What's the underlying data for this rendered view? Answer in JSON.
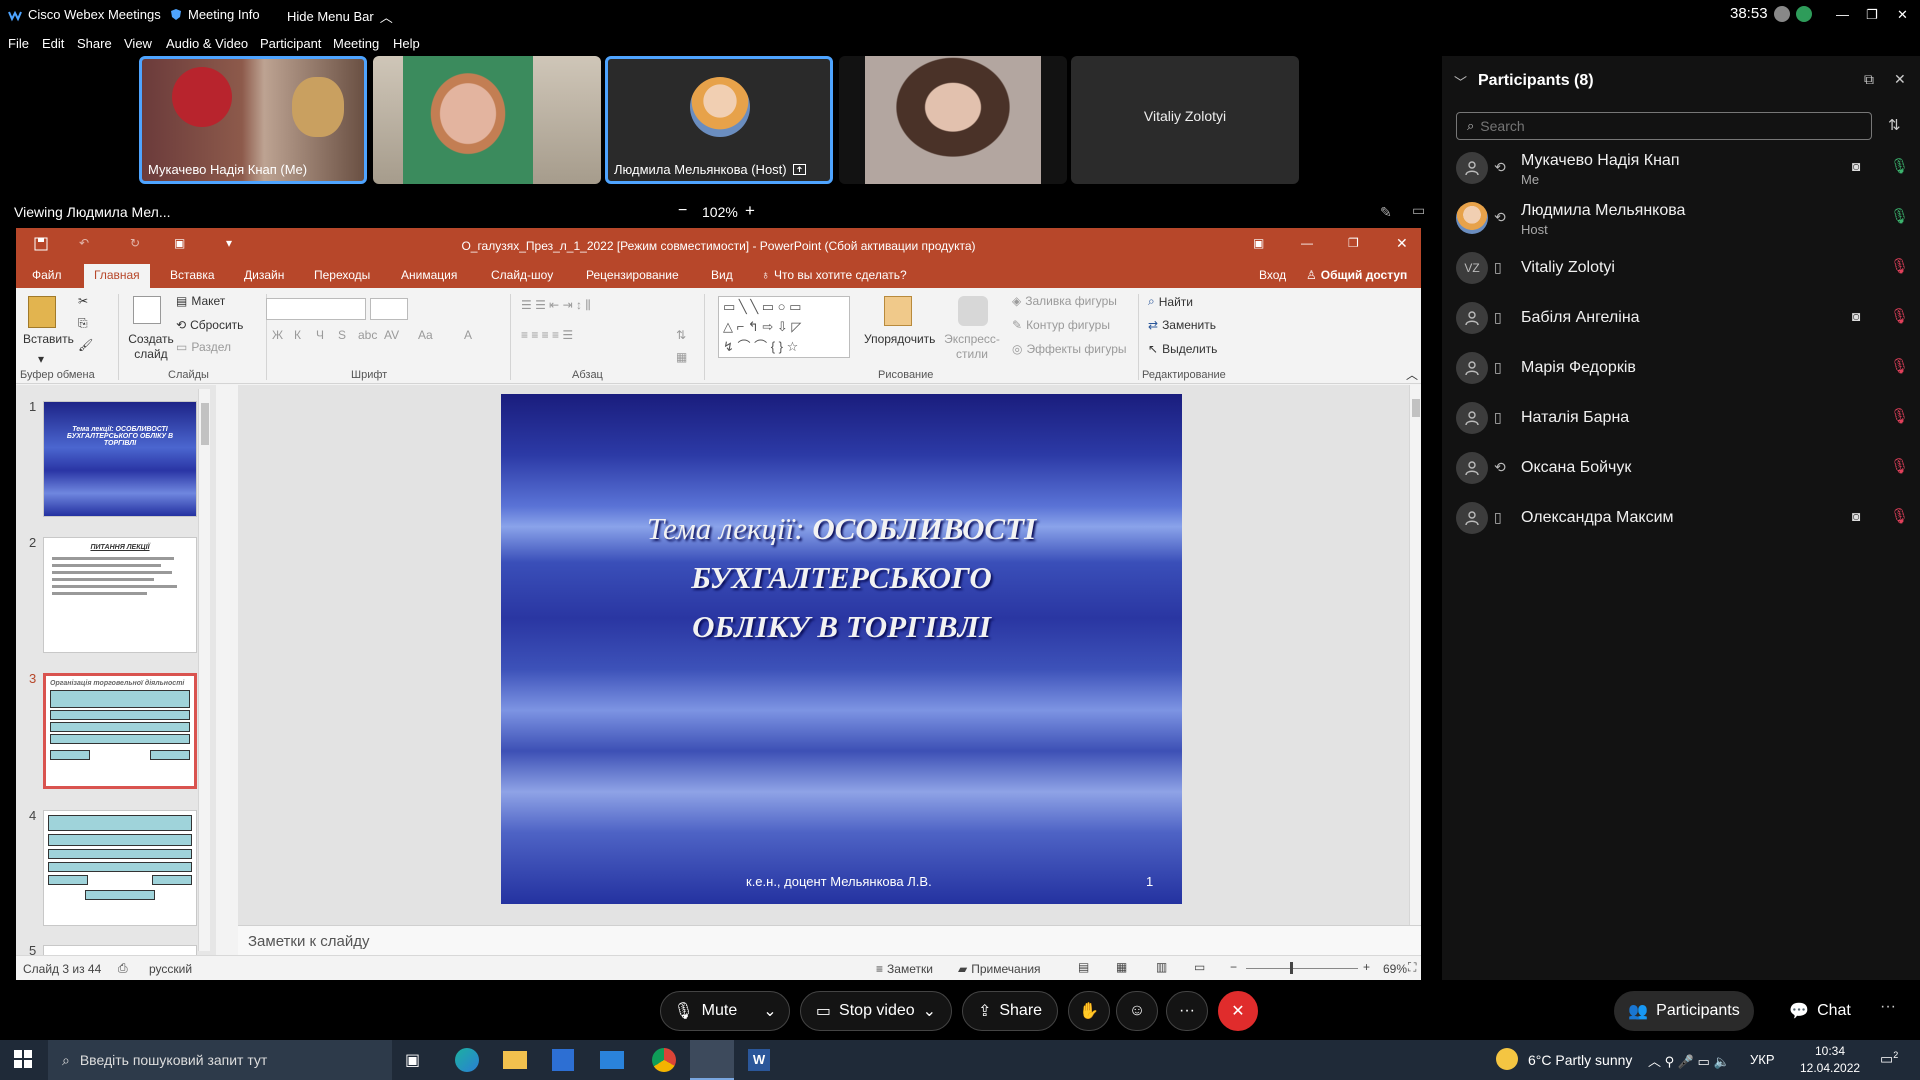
{
  "topbar": {
    "app_name": "Cisco Webex Meetings",
    "meeting_info": "Meeting Info",
    "hide_menu": "Hide Menu Bar",
    "timer": "38:53"
  },
  "menu": [
    "File",
    "Edit",
    "Share",
    "View",
    "Audio & Video",
    "Participant",
    "Meeting",
    "Help"
  ],
  "videos": [
    {
      "name": "Мукачево Надія Кнап (Me)"
    },
    {
      "name": ""
    },
    {
      "name": "Людмила Мельянкова (Host)"
    },
    {
      "name": ""
    },
    {
      "name": "Vitaliy Zolotyi"
    }
  ],
  "viewing": {
    "label": "Viewing Людмила Мел...",
    "zoom": "102%",
    "minus": "−",
    "plus": "+"
  },
  "ppt": {
    "title": "О_галузях_През_л_1_2022 [Режим совместимости] - PowerPoint (Сбой активации продукта)",
    "tabs": [
      "Файл",
      "Главная",
      "Вставка",
      "Дизайн",
      "Переходы",
      "Анимация",
      "Слайд-шоу",
      "Рецензирование",
      "Вид"
    ],
    "tell_me": "Что вы хотите сделать?",
    "signin": "Вход",
    "share": "Общий доступ",
    "ribbon": {
      "paste": "Вставить",
      "new_slide": "Создать слайд",
      "layout": "Макет",
      "reset": "Сбросить",
      "section": "Раздел",
      "arrange": "Упорядочить",
      "quick_styles": "Экспресс-стили",
      "fill": "Заливка фигуры",
      "outline": "Контур фигуры",
      "effects": "Эффекты фигуры",
      "find": "Найти",
      "replace": "Заменить",
      "select": "Выделить",
      "groups": {
        "clipboard": "Буфер обмена",
        "slides": "Слайды",
        "font": "Шрифт",
        "paragraph": "Абзац",
        "drawing": "Рисование",
        "editing": "Редактирование"
      },
      "font_btns": [
        "Ж",
        "К",
        "Ч",
        "S",
        "abc",
        "AV",
        "Aa",
        "A"
      ]
    },
    "thumbs": [
      {
        "n": "1",
        "text": "Тема лекції: ОСОБЛИВОСТІ БУХГАЛТЕРСЬКОГО ОБЛІКУ В ТОРГІВЛІ"
      },
      {
        "n": "2",
        "text": "ПИТАННЯ ЛЕКЦІЇ"
      },
      {
        "n": "3",
        "text": "Організація торговельної діяльності"
      },
      {
        "n": "4",
        "text": ""
      },
      {
        "n": "5",
        "text": ""
      }
    ],
    "slide": {
      "line1_a": "Тема лекції: ",
      "line1_b": "ОСОБЛИВОСТІ",
      "line2": "БУХГАЛТЕРСЬКОГО",
      "line3": "ОБЛІКУ В ТОРГІВЛІ",
      "author": "к.е.н., доцент Мельянкова Л.В.",
      "number": "1"
    },
    "notes": "Заметки к слайду",
    "status": {
      "slide": "Слайд 3 из 44",
      "lang": "русский",
      "notes": "Заметки",
      "comments": "Примечания",
      "zoom": "69%"
    }
  },
  "participants": {
    "title": "Participants (8)",
    "search_placeholder": "Search",
    "list": [
      {
        "name": "Мукачево Надія Кнап",
        "sub": "Me",
        "initials": "",
        "video": true,
        "muted": false
      },
      {
        "name": "Людмила Мельянкова",
        "sub": "Host",
        "initials": "",
        "video": false,
        "muted": false
      },
      {
        "name": "Vitaliy Zolotyi",
        "sub": "",
        "initials": "VZ",
        "video": false,
        "muted": true
      },
      {
        "name": "Бабіля Ангеліна",
        "sub": "",
        "initials": "",
        "video": true,
        "muted": true
      },
      {
        "name": "Марія Федорків",
        "sub": "",
        "initials": "",
        "video": false,
        "muted": true
      },
      {
        "name": "Наталія Барна",
        "sub": "",
        "initials": "",
        "video": false,
        "muted": true
      },
      {
        "name": "Оксана Бойчук",
        "sub": "",
        "initials": "",
        "video": false,
        "muted": true
      },
      {
        "name": "Олександра Максим",
        "sub": "",
        "initials": "",
        "video": true,
        "muted": true
      }
    ]
  },
  "controls": {
    "mute": "Mute",
    "stop_video": "Stop video",
    "share": "Share",
    "more": "···",
    "participants": "Participants",
    "chat": "Chat"
  },
  "taskbar": {
    "search": "Введіть пошуковий запит тут",
    "weather": "6°C  Partly sunny",
    "lang": "УКР",
    "time": "10:34",
    "date": "12.04.2022",
    "notif": "2"
  },
  "colors": {
    "ppt_red": "#b7472a",
    "active_blue": "#4ea4ff",
    "end_red": "#e02c2c",
    "unmute_green": "#3cb46e",
    "muted_red": "#e0405a"
  }
}
